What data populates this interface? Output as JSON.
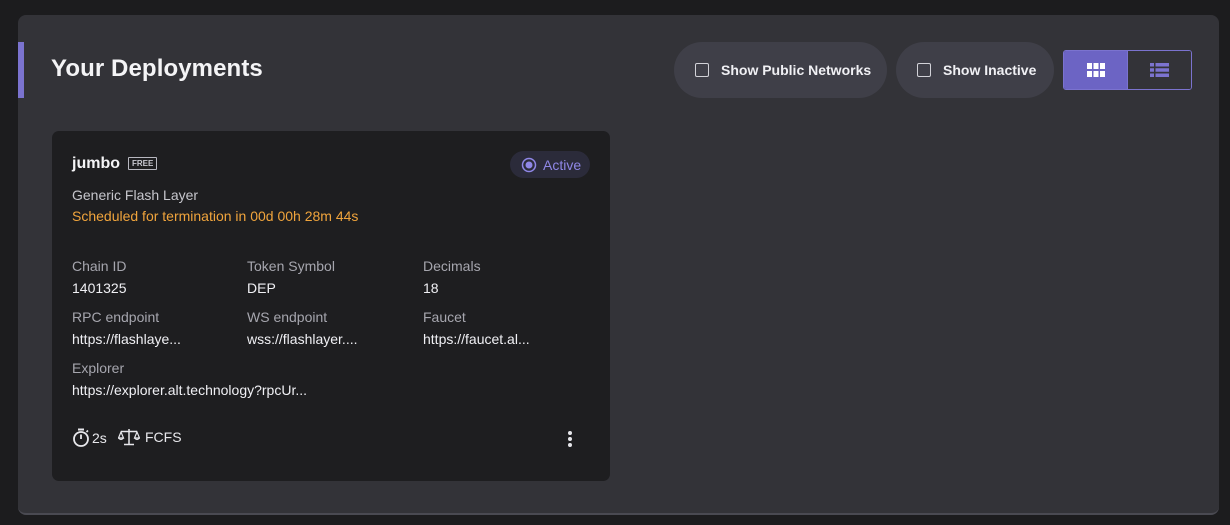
{
  "header": {
    "title": "Your Deployments",
    "show_public_networks_label": "Show Public Networks",
    "show_public_networks_checked": false,
    "show_inactive_label": "Show Inactive",
    "show_inactive_checked": false,
    "view_mode": "grid",
    "grid_view_icon": "grid-icon",
    "list_view_icon": "list-icon"
  },
  "deployment": {
    "name": "jumbo",
    "badge": "FREE",
    "status": "Active",
    "status_icon": "radio-dot-icon",
    "type": "Generic Flash Layer",
    "termination": "Scheduled for termination in 00d 00h 28m 44s",
    "fields": {
      "chain_id": {
        "label": "Chain ID",
        "value": "1401325"
      },
      "token_symbol": {
        "label": "Token Symbol",
        "value": "DEP"
      },
      "decimals": {
        "label": "Decimals",
        "value": "18"
      },
      "rpc_endpoint": {
        "label": "RPC endpoint",
        "value": "https://flashlaye..."
      },
      "ws_endpoint": {
        "label": "WS endpoint",
        "value": "wss://flashlayer...."
      },
      "faucet": {
        "label": "Faucet",
        "value": "https://faucet.al..."
      },
      "explorer": {
        "label": "Explorer",
        "value": "https://explorer.alt.technology?rpcUr..."
      }
    },
    "block_time": "2s",
    "block_time_icon": "stopwatch-icon",
    "sequencing": "FCFS",
    "sequencing_icon": "scales-icon",
    "menu_icon": "more-vertical-icon"
  },
  "colors": {
    "accent": "#7b73cf",
    "status": "#8f87e6",
    "warning": "#f0a43c"
  }
}
